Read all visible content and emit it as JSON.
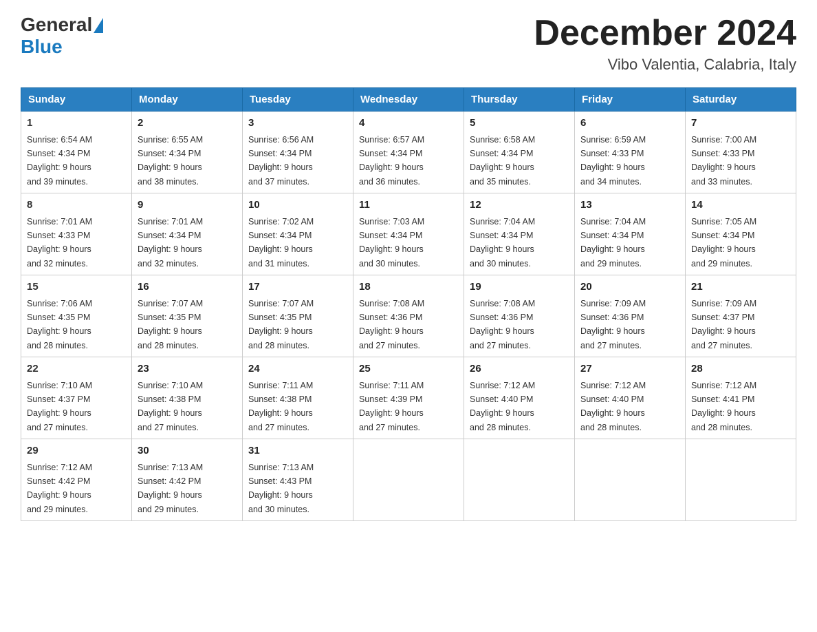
{
  "logo": {
    "general": "General",
    "blue": "Blue"
  },
  "title": {
    "month": "December 2024",
    "location": "Vibo Valentia, Calabria, Italy"
  },
  "headers": [
    "Sunday",
    "Monday",
    "Tuesday",
    "Wednesday",
    "Thursday",
    "Friday",
    "Saturday"
  ],
  "weeks": [
    [
      {
        "day": "1",
        "sunrise": "6:54 AM",
        "sunset": "4:34 PM",
        "daylight": "9 hours and 39 minutes."
      },
      {
        "day": "2",
        "sunrise": "6:55 AM",
        "sunset": "4:34 PM",
        "daylight": "9 hours and 38 minutes."
      },
      {
        "day": "3",
        "sunrise": "6:56 AM",
        "sunset": "4:34 PM",
        "daylight": "9 hours and 37 minutes."
      },
      {
        "day": "4",
        "sunrise": "6:57 AM",
        "sunset": "4:34 PM",
        "daylight": "9 hours and 36 minutes."
      },
      {
        "day": "5",
        "sunrise": "6:58 AM",
        "sunset": "4:34 PM",
        "daylight": "9 hours and 35 minutes."
      },
      {
        "day": "6",
        "sunrise": "6:59 AM",
        "sunset": "4:33 PM",
        "daylight": "9 hours and 34 minutes."
      },
      {
        "day": "7",
        "sunrise": "7:00 AM",
        "sunset": "4:33 PM",
        "daylight": "9 hours and 33 minutes."
      }
    ],
    [
      {
        "day": "8",
        "sunrise": "7:01 AM",
        "sunset": "4:33 PM",
        "daylight": "9 hours and 32 minutes."
      },
      {
        "day": "9",
        "sunrise": "7:01 AM",
        "sunset": "4:34 PM",
        "daylight": "9 hours and 32 minutes."
      },
      {
        "day": "10",
        "sunrise": "7:02 AM",
        "sunset": "4:34 PM",
        "daylight": "9 hours and 31 minutes."
      },
      {
        "day": "11",
        "sunrise": "7:03 AM",
        "sunset": "4:34 PM",
        "daylight": "9 hours and 30 minutes."
      },
      {
        "day": "12",
        "sunrise": "7:04 AM",
        "sunset": "4:34 PM",
        "daylight": "9 hours and 30 minutes."
      },
      {
        "day": "13",
        "sunrise": "7:04 AM",
        "sunset": "4:34 PM",
        "daylight": "9 hours and 29 minutes."
      },
      {
        "day": "14",
        "sunrise": "7:05 AM",
        "sunset": "4:34 PM",
        "daylight": "9 hours and 29 minutes."
      }
    ],
    [
      {
        "day": "15",
        "sunrise": "7:06 AM",
        "sunset": "4:35 PM",
        "daylight": "9 hours and 28 minutes."
      },
      {
        "day": "16",
        "sunrise": "7:07 AM",
        "sunset": "4:35 PM",
        "daylight": "9 hours and 28 minutes."
      },
      {
        "day": "17",
        "sunrise": "7:07 AM",
        "sunset": "4:35 PM",
        "daylight": "9 hours and 28 minutes."
      },
      {
        "day": "18",
        "sunrise": "7:08 AM",
        "sunset": "4:36 PM",
        "daylight": "9 hours and 27 minutes."
      },
      {
        "day": "19",
        "sunrise": "7:08 AM",
        "sunset": "4:36 PM",
        "daylight": "9 hours and 27 minutes."
      },
      {
        "day": "20",
        "sunrise": "7:09 AM",
        "sunset": "4:36 PM",
        "daylight": "9 hours and 27 minutes."
      },
      {
        "day": "21",
        "sunrise": "7:09 AM",
        "sunset": "4:37 PM",
        "daylight": "9 hours and 27 minutes."
      }
    ],
    [
      {
        "day": "22",
        "sunrise": "7:10 AM",
        "sunset": "4:37 PM",
        "daylight": "9 hours and 27 minutes."
      },
      {
        "day": "23",
        "sunrise": "7:10 AM",
        "sunset": "4:38 PM",
        "daylight": "9 hours and 27 minutes."
      },
      {
        "day": "24",
        "sunrise": "7:11 AM",
        "sunset": "4:38 PM",
        "daylight": "9 hours and 27 minutes."
      },
      {
        "day": "25",
        "sunrise": "7:11 AM",
        "sunset": "4:39 PM",
        "daylight": "9 hours and 27 minutes."
      },
      {
        "day": "26",
        "sunrise": "7:12 AM",
        "sunset": "4:40 PM",
        "daylight": "9 hours and 28 minutes."
      },
      {
        "day": "27",
        "sunrise": "7:12 AM",
        "sunset": "4:40 PM",
        "daylight": "9 hours and 28 minutes."
      },
      {
        "day": "28",
        "sunrise": "7:12 AM",
        "sunset": "4:41 PM",
        "daylight": "9 hours and 28 minutes."
      }
    ],
    [
      {
        "day": "29",
        "sunrise": "7:12 AM",
        "sunset": "4:42 PM",
        "daylight": "9 hours and 29 minutes."
      },
      {
        "day": "30",
        "sunrise": "7:13 AM",
        "sunset": "4:42 PM",
        "daylight": "9 hours and 29 minutes."
      },
      {
        "day": "31",
        "sunrise": "7:13 AM",
        "sunset": "4:43 PM",
        "daylight": "9 hours and 30 minutes."
      },
      null,
      null,
      null,
      null
    ]
  ],
  "labels": {
    "sunrise": "Sunrise:",
    "sunset": "Sunset:",
    "daylight": "Daylight:"
  }
}
